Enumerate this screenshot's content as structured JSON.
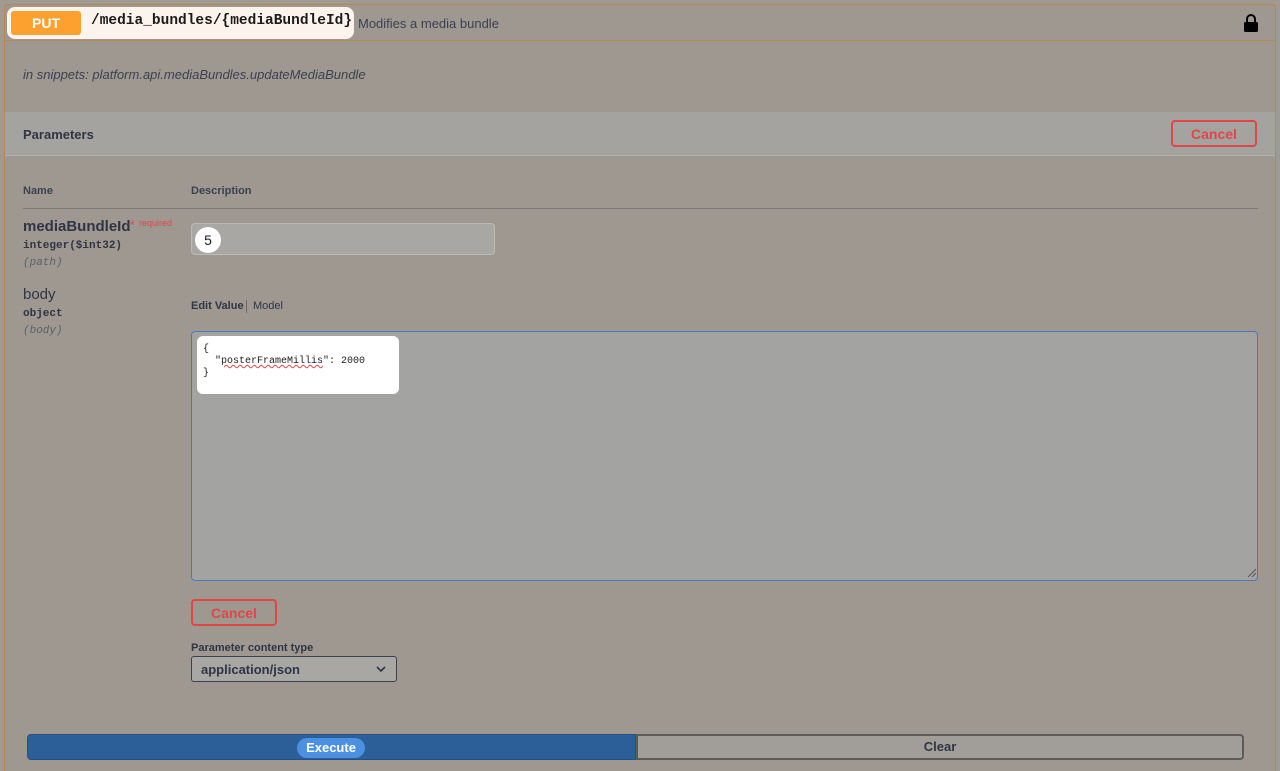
{
  "operation": {
    "method": "PUT",
    "path": "/media_bundles/{mediaBundleId}",
    "summary": "Modifies a media bundle",
    "snippet": "in snippets: platform.api.mediaBundles.updateMediaBundle"
  },
  "parameters": {
    "title": "Parameters",
    "cancel_label": "Cancel",
    "col_name": "Name",
    "col_description": "Description",
    "items": [
      {
        "name": "mediaBundleId",
        "required_star": "*",
        "required_label": "required",
        "type": "integer($int32)",
        "in": "(path)",
        "value": "5"
      },
      {
        "name": "body",
        "type": "object",
        "in": "(body)",
        "tab_edit": "Edit Value",
        "tab_model": "Model",
        "value_line1": "{",
        "value_line2_pre": "  \"",
        "value_line2_key": "posterFrameMillis",
        "value_line2_post": "\": 2000",
        "value_line3": "}"
      }
    ],
    "body_cancel_label": "Cancel",
    "content_type_label": "Parameter content type",
    "content_type_value": "application/json"
  },
  "actions": {
    "execute_label": "Execute",
    "clear_label": "Clear"
  },
  "colors": {
    "method_put": "#fca130",
    "cancel_red": "#e04646",
    "execute_blue": "#2c5e98"
  }
}
